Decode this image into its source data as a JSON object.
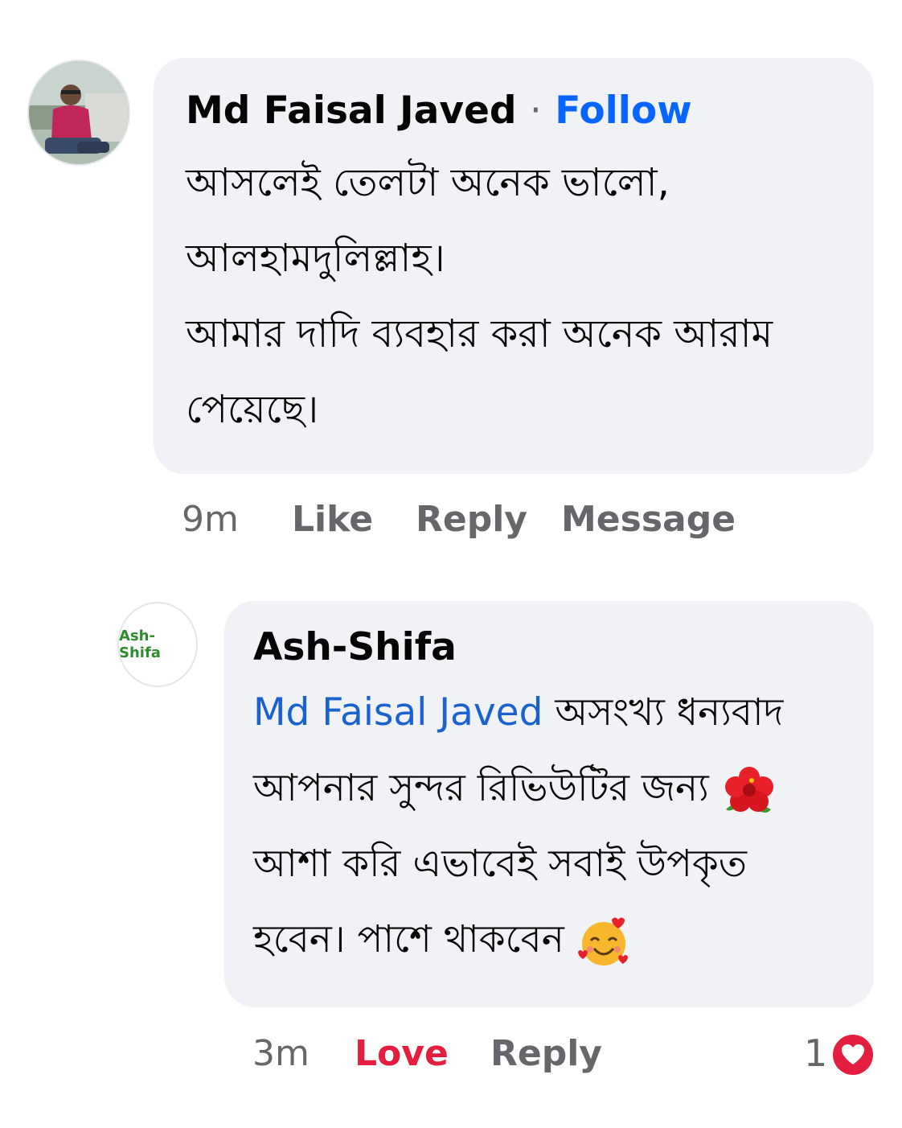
{
  "comment1": {
    "author": "Md Faisal Javed",
    "separator": "·",
    "follow_label": "Follow",
    "lines": [
      "আসলেই তেলটা অনেক ভালো,",
      "আলহামদুলিল্লাহ।",
      "আমার দাদি ব্যবহার করা অনেক আরাম",
      "পেয়েছে।"
    ],
    "time": "9m",
    "actions": {
      "like": "Like",
      "reply": "Reply",
      "message": "Message"
    }
  },
  "comment2": {
    "avatar_logo_text": "Ash-Shifa",
    "author": "Ash-Shifa",
    "mention": "Md Faisal Javed",
    "line1_rest": " অসংখ্য ধন্যবাদ",
    "line2": "আপনার সুন্দর রিভিউটির জন্য",
    "line3": "আশা করি এভাবেই সবাই উপকৃত",
    "line4": "হবেন। পাশে থাকবেন",
    "icons": {
      "line2_emoji": "hibiscus-icon",
      "line4_emoji": "smiling-face-with-hearts-icon"
    },
    "time": "3m",
    "actions": {
      "love": "Love",
      "reply": "Reply"
    },
    "reaction_count": "1"
  },
  "colors": {
    "link_blue": "#0866ff",
    "love_red": "#e41e3f",
    "bubble_bg": "#f0f2f5",
    "meta_gray": "#65676b"
  }
}
